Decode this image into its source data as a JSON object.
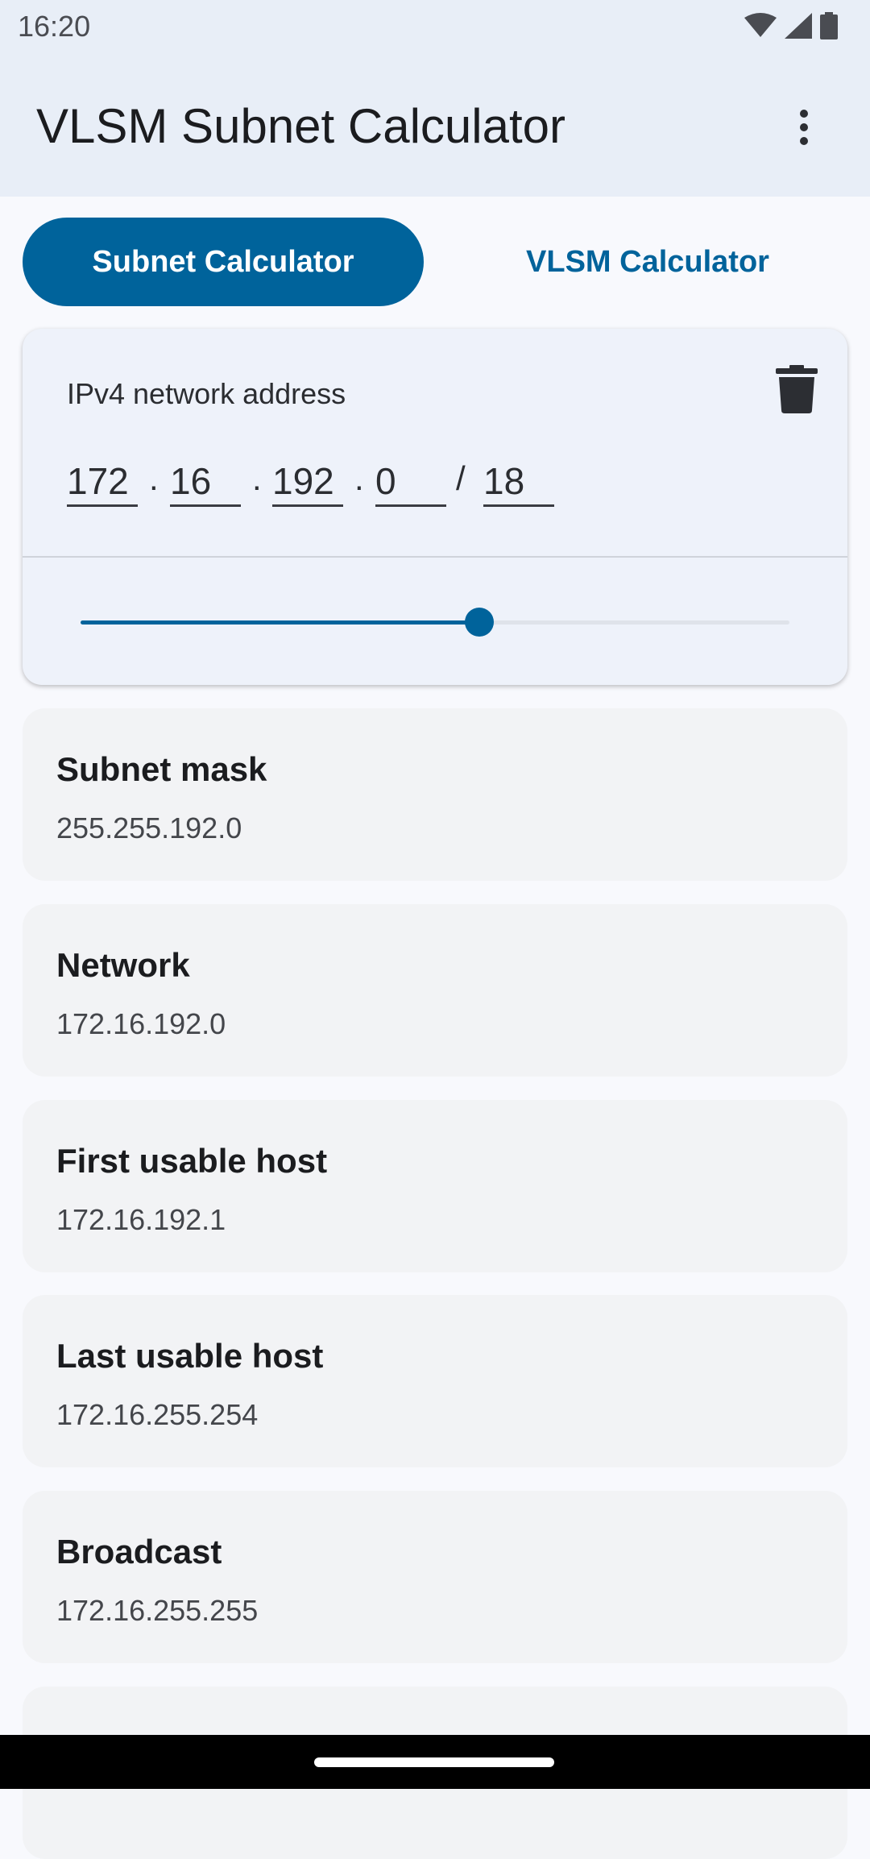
{
  "status_bar": {
    "time": "16:20",
    "icons": [
      "wifi-icon",
      "signal-icon",
      "battery-icon"
    ]
  },
  "app_bar": {
    "title": "VLSM Subnet Calculator",
    "menu_icon": "more-vert-icon"
  },
  "tabs": [
    {
      "label": "Subnet Calculator",
      "active": true
    },
    {
      "label": "VLSM Calculator",
      "active": false
    }
  ],
  "input": {
    "label": "IPv4 network address",
    "octets": [
      "172",
      "16",
      "192",
      "0"
    ],
    "dot": ".",
    "slash": "/",
    "prefix": "18",
    "delete_icon": "trash-icon",
    "slider": {
      "min": 0,
      "max": 32,
      "value": 18
    }
  },
  "results": [
    {
      "title": "Subnet mask",
      "value": "255.255.192.0"
    },
    {
      "title": "Network",
      "value": "172.16.192.0"
    },
    {
      "title": "First usable host",
      "value": "172.16.192.1"
    },
    {
      "title": "Last usable host",
      "value": "172.16.255.254"
    },
    {
      "title": "Broadcast",
      "value": "172.16.255.255"
    }
  ],
  "colors": {
    "primary": "#00639b",
    "app_bar": "#e8eef7",
    "card": "#f2f3f5"
  }
}
